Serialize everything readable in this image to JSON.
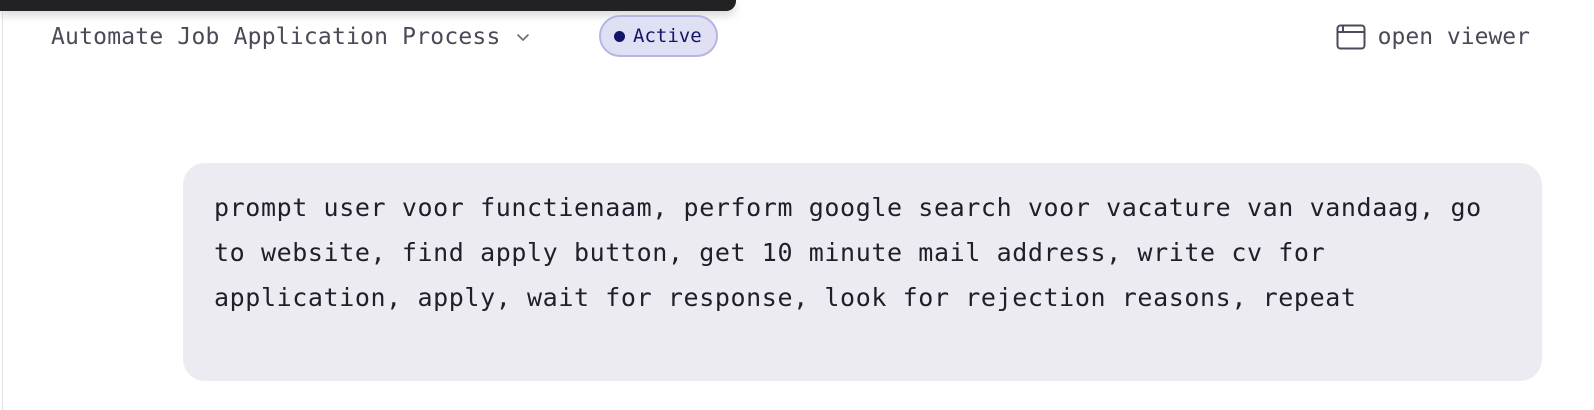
{
  "header": {
    "title": "Automate Job Application Process",
    "title_icon": "chevron-down-icon",
    "status": {
      "label": "Active",
      "color": "#151568",
      "background": "#dfe0f4"
    },
    "viewer_button": {
      "label": "open viewer",
      "icon": "browser-window-icon"
    }
  },
  "conversation": {
    "messages": [
      {
        "role": "user",
        "text": "prompt user voor functienaam, perform google search voor vacature van vandaag, go to website, find apply button, get 10 minute mail address, write cv for application, apply, wait for response, look for rejection reasons, repeat"
      }
    ]
  }
}
